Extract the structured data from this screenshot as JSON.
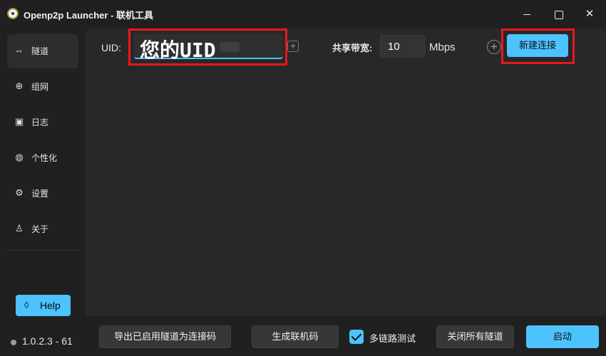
{
  "window": {
    "title": "Openp2p Launcher - 联机工具",
    "minimize_label": "",
    "maximize_label": "",
    "close_label": "✕"
  },
  "sidebar": {
    "items": [
      {
        "label": "隧道",
        "icon": "link-icon",
        "glyph": "⇔",
        "active": true
      },
      {
        "label": "组网",
        "icon": "globe-icon",
        "glyph": "⊕",
        "active": false
      },
      {
        "label": "日志",
        "icon": "terminal-icon",
        "glyph": "▣",
        "active": false
      },
      {
        "label": "个性化",
        "icon": "palette-icon",
        "glyph": "◍",
        "active": false
      },
      {
        "label": "设置",
        "icon": "gear-icon",
        "glyph": "⚙",
        "active": false
      },
      {
        "label": "关于",
        "icon": "user-info-icon",
        "glyph": "♙",
        "active": false
      }
    ],
    "help_label": "Help",
    "help_glyph": "◊",
    "version": "1.0.2.3 - 61"
  },
  "tunnel": {
    "uid_label": "UID:",
    "uid_value": "您的UID",
    "uid_add_glyph": "+",
    "bandwidth_label": "共享带宽:",
    "bandwidth_value": "10",
    "bandwidth_unit": "Mbps",
    "add_glyph": "+",
    "new_connection_label": "新建连接"
  },
  "footer": {
    "export_label": "导出已启用隧道为连接码",
    "generate_label": "生成联机码",
    "multilink_label": "多链路测试",
    "multilink_checked": true,
    "close_all_label": "关闭所有隧道",
    "start_label": "启动"
  },
  "colors": {
    "accent": "#4cc2ff",
    "highlight": "#e8171b",
    "background": "#202020",
    "panel": "#282828"
  }
}
